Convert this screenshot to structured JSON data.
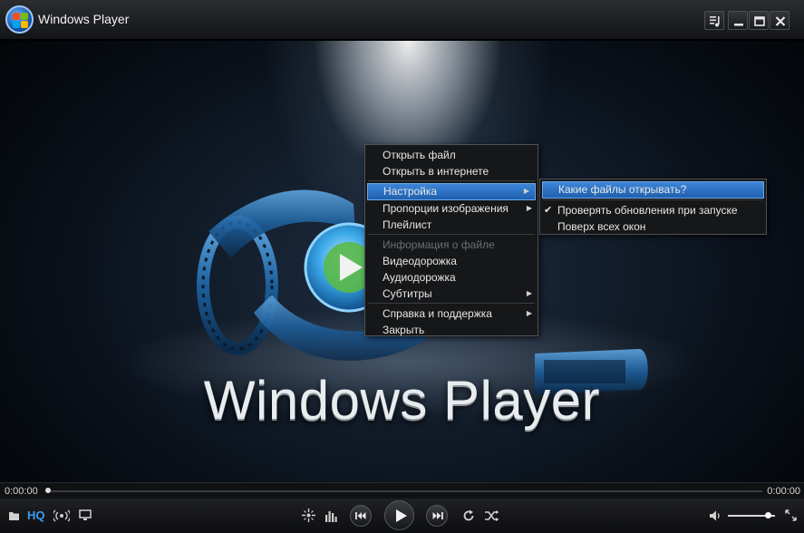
{
  "window": {
    "title": "Windows Player"
  },
  "video": {
    "brand_text": "Windows Player"
  },
  "context_menu": {
    "items": [
      {
        "label": "Открыть файл",
        "state": "normal"
      },
      {
        "label": "Открыть в интернете",
        "state": "normal"
      },
      {
        "label": "Настройка",
        "state": "selected",
        "submenu": true
      },
      {
        "label": "Пропорции изображения",
        "state": "normal",
        "submenu": true
      },
      {
        "label": "Плейлист",
        "state": "normal"
      },
      {
        "label": "Информация о файле",
        "state": "disabled"
      },
      {
        "label": "Видеодорожка",
        "state": "normal"
      },
      {
        "label": "Аудиодорожка",
        "state": "normal"
      },
      {
        "label": "Субтитры",
        "state": "normal",
        "submenu": true
      },
      {
        "label": "Справка и поддержка",
        "state": "normal",
        "submenu": true
      },
      {
        "label": "Закрыть",
        "state": "normal"
      }
    ],
    "submenu": {
      "items": [
        {
          "label": "Какие файлы открывать?",
          "state": "selected"
        },
        {
          "label": "Проверять обновления при запуске",
          "state": "checked"
        },
        {
          "label": "Поверх всех окон",
          "state": "normal"
        }
      ]
    }
  },
  "seekbar": {
    "elapsed": "0:00:00",
    "total": "0:00:00",
    "progress": 0
  },
  "controls": {
    "hq_label": "HQ",
    "volume": 0.85
  },
  "colors": {
    "accent": "#1e90ff",
    "menu_highlight": "#2f74c7",
    "hq": "#3a9df2"
  }
}
